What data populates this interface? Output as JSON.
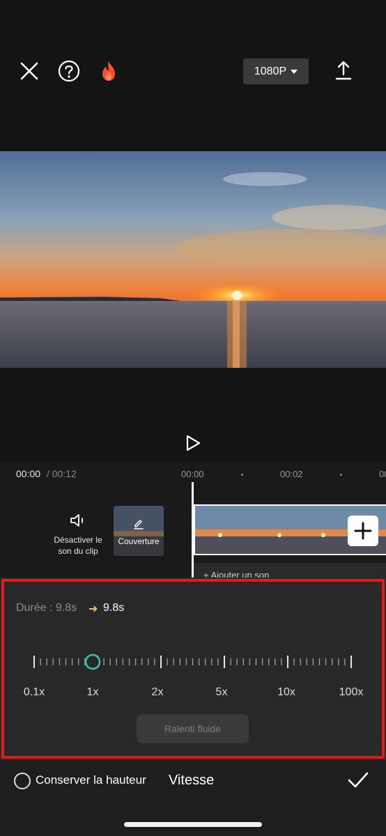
{
  "toolbar": {
    "resolution_label": "1080P",
    "icons": [
      "close-icon",
      "help-icon",
      "fire-icon",
      "caret-down-icon",
      "export-icon"
    ]
  },
  "preview": {
    "image": "sunset over sea"
  },
  "timeline": {
    "current_time": "00:00",
    "total_time": "/ 00:12",
    "ticks": [
      "00:00",
      "00:02",
      "00"
    ],
    "mute_label_line1": "Désactiver le",
    "mute_label_line2": "son du clip",
    "cover_label": "Couverture",
    "add_audio_label": "+ Ajouter un son"
  },
  "speed_panel": {
    "duration_label": "Durée : 9.8s",
    "arrow": "➜",
    "duration_new": "9.8s",
    "scale_labels": [
      "0.1x",
      "1x",
      "2x",
      "5x",
      "10x",
      "100x"
    ],
    "selected_value": "1x",
    "smooth_button_label": "Ralenti fluide",
    "accent_color": "#2ec4b6",
    "highlight_color": "#e01b1b"
  },
  "bottom": {
    "keep_pitch_label": "Conserver la hauteur",
    "title": "Vitesse"
  }
}
